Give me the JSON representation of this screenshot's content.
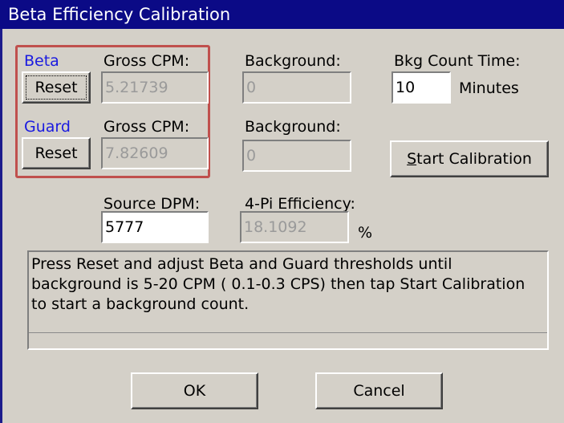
{
  "window": {
    "title": "Beta Efficiency Calibration"
  },
  "beta": {
    "label": "Beta",
    "reset_label": "Reset",
    "gross_label": "Gross CPM:",
    "gross_value": "5.21739",
    "background_label": "Background:",
    "background_value": "0"
  },
  "guard": {
    "label": "Guard",
    "reset_label": "Reset",
    "gross_label": "Gross CPM:",
    "gross_value": "7.82609",
    "background_label": "Background:",
    "background_value": "0"
  },
  "bkg_count": {
    "label": "Bkg Count Time:",
    "value": "10",
    "unit": "Minutes"
  },
  "start_calibration": {
    "prefix": "S",
    "rest": "tart Calibration"
  },
  "source_dpm": {
    "label": "Source DPM:",
    "value": "5777"
  },
  "efficiency": {
    "label": "4-Pi Efficiency:",
    "value": "18.1092",
    "unit": "%"
  },
  "message": "Press Reset and adjust Beta and Guard thresholds until background is 5-20 CPM ( 0.1-0.3 CPS) then tap Start Calibration to start a background count.",
  "buttons": {
    "ok": "OK",
    "cancel": "Cancel"
  },
  "colors": {
    "title_bar": "#0b0a86",
    "highlight_box": "#c0504d",
    "channel_label": "#1a1ae0"
  }
}
